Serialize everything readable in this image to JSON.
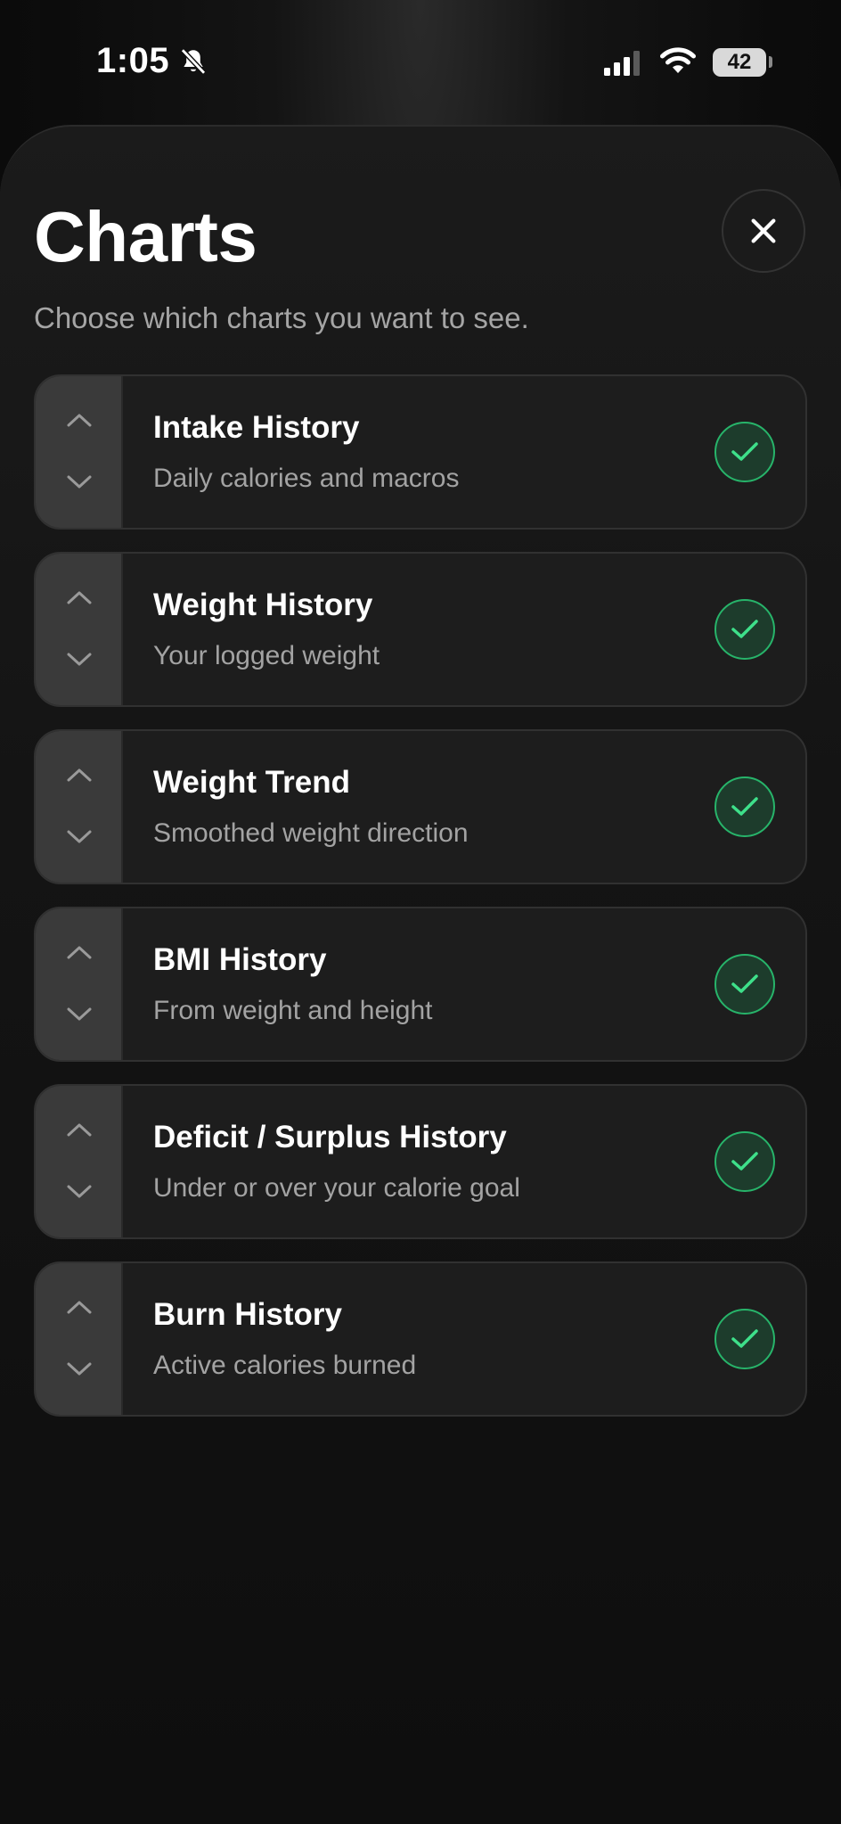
{
  "status_bar": {
    "time": "1:05",
    "battery": "42"
  },
  "sheet": {
    "title": "Charts",
    "subtitle": "Choose which charts you want to see."
  },
  "colors": {
    "accent_green": "#27b46a",
    "check_fill": "#1d3c2c",
    "background": "#0b0b0b"
  },
  "charts": [
    {
      "title": "Intake History",
      "description": "Daily calories and macros",
      "enabled": true
    },
    {
      "title": "Weight History",
      "description": "Your logged weight",
      "enabled": true
    },
    {
      "title": "Weight Trend",
      "description": "Smoothed weight direction",
      "enabled": true
    },
    {
      "title": "BMI History",
      "description": "From weight and height",
      "enabled": true
    },
    {
      "title": "Deficit / Surplus History",
      "description": "Under or over your calorie goal",
      "enabled": true
    },
    {
      "title": "Burn History",
      "description": "Active calories burned",
      "enabled": true
    }
  ]
}
